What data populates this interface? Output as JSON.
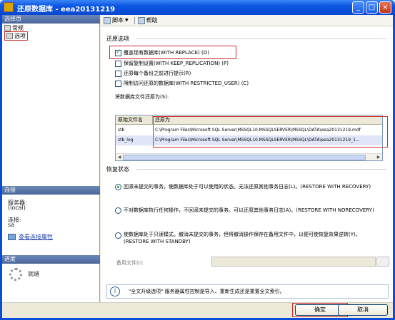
{
  "window": {
    "title": "还原数据库 - eea20131219",
    "minimize": "_",
    "maximize": "□",
    "close": "×"
  },
  "left": {
    "pages_header": "选择页",
    "pages": [
      {
        "label": "常规",
        "selected": false
      },
      {
        "label": "选项",
        "selected": true
      }
    ],
    "connection_header": "连接",
    "server_label": "服务器:",
    "server_value": "(local)",
    "connection_label": "连接:",
    "connection_value": "sa",
    "view_link": "查看连接属性",
    "progress_header": "进度",
    "progress_status": "就绪"
  },
  "toolbar": {
    "script_label": "脚本",
    "help_label": "帮助"
  },
  "restore_options": {
    "title": "还原选项",
    "options": [
      {
        "label": "覆盖现有数据库(WITH REPLACE) (O)",
        "checked": true
      },
      {
        "label": "保留复制设置(WITH KEEP_REPLICATION) (P)",
        "checked": false
      },
      {
        "label": "还原每个备份之前进行提示(R)",
        "checked": false
      },
      {
        "label": "限制访问还原的数据库(WITH RESTRICTED_USER) (C)",
        "checked": false
      }
    ],
    "restore_as_label": "将数据库文件还原为(S):"
  },
  "file_grid": {
    "columns": [
      "原始文件名",
      "还原为"
    ],
    "rows": [
      {
        "original": "stb",
        "restore_as": "C:\\Program Files\\Microsoft SQL Server\\MSSQL10.MSSQLSERVER\\MSSQL\\DATA\\eea20131219.mdf"
      },
      {
        "original": "stb_log",
        "restore_as": "C:\\Program Files\\Microsoft SQL Server\\MSSQL10.MSSQLSERVER\\MSSQL\\DATA\\eea20131219_1..."
      }
    ]
  },
  "recovery": {
    "title": "恢复状态",
    "options": [
      {
        "label": "回滚未提交的事务，使数据库处于可以使用的状态。无法还原其他事务日志(L)。(RESTORE WITH RECOVERY)",
        "checked": true
      },
      {
        "label": "不对数据库执行任何操作，不回滚未提交的事务。可以还原其他事务日志(A)。(RESTORE WITH NORECOVERY)",
        "checked": false
      },
      {
        "label": "使数据库处于只读模式。撤消未提交的事务，但将撤消操作保存在备用文件中，以便可使恢复效果逆转(Y)。(RESTORE WITH STANDBY)",
        "checked": false
      }
    ],
    "standby_label": "备用文件(I):",
    "standby_value": ""
  },
  "info_message": "\"全文升级选项\" 服务器属性控制是导入、重新生成还是重置全文索引。",
  "buttons": {
    "ok": "确定",
    "cancel": "取消"
  },
  "colors": {
    "titlebar": "#0b55e2",
    "highlight_box": "#d03030",
    "check_green": "#21a121"
  }
}
